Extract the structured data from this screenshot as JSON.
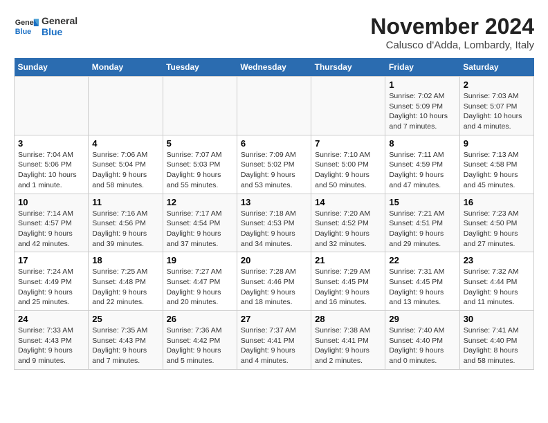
{
  "header": {
    "logo_line1": "General",
    "logo_line2": "Blue",
    "month": "November 2024",
    "location": "Calusco d'Adda, Lombardy, Italy"
  },
  "weekdays": [
    "Sunday",
    "Monday",
    "Tuesday",
    "Wednesday",
    "Thursday",
    "Friday",
    "Saturday"
  ],
  "weeks": [
    [
      {
        "day": "",
        "info": ""
      },
      {
        "day": "",
        "info": ""
      },
      {
        "day": "",
        "info": ""
      },
      {
        "day": "",
        "info": ""
      },
      {
        "day": "",
        "info": ""
      },
      {
        "day": "1",
        "info": "Sunrise: 7:02 AM\nSunset: 5:09 PM\nDaylight: 10 hours and 7 minutes."
      },
      {
        "day": "2",
        "info": "Sunrise: 7:03 AM\nSunset: 5:07 PM\nDaylight: 10 hours and 4 minutes."
      }
    ],
    [
      {
        "day": "3",
        "info": "Sunrise: 7:04 AM\nSunset: 5:06 PM\nDaylight: 10 hours and 1 minute."
      },
      {
        "day": "4",
        "info": "Sunrise: 7:06 AM\nSunset: 5:04 PM\nDaylight: 9 hours and 58 minutes."
      },
      {
        "day": "5",
        "info": "Sunrise: 7:07 AM\nSunset: 5:03 PM\nDaylight: 9 hours and 55 minutes."
      },
      {
        "day": "6",
        "info": "Sunrise: 7:09 AM\nSunset: 5:02 PM\nDaylight: 9 hours and 53 minutes."
      },
      {
        "day": "7",
        "info": "Sunrise: 7:10 AM\nSunset: 5:00 PM\nDaylight: 9 hours and 50 minutes."
      },
      {
        "day": "8",
        "info": "Sunrise: 7:11 AM\nSunset: 4:59 PM\nDaylight: 9 hours and 47 minutes."
      },
      {
        "day": "9",
        "info": "Sunrise: 7:13 AM\nSunset: 4:58 PM\nDaylight: 9 hours and 45 minutes."
      }
    ],
    [
      {
        "day": "10",
        "info": "Sunrise: 7:14 AM\nSunset: 4:57 PM\nDaylight: 9 hours and 42 minutes."
      },
      {
        "day": "11",
        "info": "Sunrise: 7:16 AM\nSunset: 4:56 PM\nDaylight: 9 hours and 39 minutes."
      },
      {
        "day": "12",
        "info": "Sunrise: 7:17 AM\nSunset: 4:54 PM\nDaylight: 9 hours and 37 minutes."
      },
      {
        "day": "13",
        "info": "Sunrise: 7:18 AM\nSunset: 4:53 PM\nDaylight: 9 hours and 34 minutes."
      },
      {
        "day": "14",
        "info": "Sunrise: 7:20 AM\nSunset: 4:52 PM\nDaylight: 9 hours and 32 minutes."
      },
      {
        "day": "15",
        "info": "Sunrise: 7:21 AM\nSunset: 4:51 PM\nDaylight: 9 hours and 29 minutes."
      },
      {
        "day": "16",
        "info": "Sunrise: 7:23 AM\nSunset: 4:50 PM\nDaylight: 9 hours and 27 minutes."
      }
    ],
    [
      {
        "day": "17",
        "info": "Sunrise: 7:24 AM\nSunset: 4:49 PM\nDaylight: 9 hours and 25 minutes."
      },
      {
        "day": "18",
        "info": "Sunrise: 7:25 AM\nSunset: 4:48 PM\nDaylight: 9 hours and 22 minutes."
      },
      {
        "day": "19",
        "info": "Sunrise: 7:27 AM\nSunset: 4:47 PM\nDaylight: 9 hours and 20 minutes."
      },
      {
        "day": "20",
        "info": "Sunrise: 7:28 AM\nSunset: 4:46 PM\nDaylight: 9 hours and 18 minutes."
      },
      {
        "day": "21",
        "info": "Sunrise: 7:29 AM\nSunset: 4:45 PM\nDaylight: 9 hours and 16 minutes."
      },
      {
        "day": "22",
        "info": "Sunrise: 7:31 AM\nSunset: 4:45 PM\nDaylight: 9 hours and 13 minutes."
      },
      {
        "day": "23",
        "info": "Sunrise: 7:32 AM\nSunset: 4:44 PM\nDaylight: 9 hours and 11 minutes."
      }
    ],
    [
      {
        "day": "24",
        "info": "Sunrise: 7:33 AM\nSunset: 4:43 PM\nDaylight: 9 hours and 9 minutes."
      },
      {
        "day": "25",
        "info": "Sunrise: 7:35 AM\nSunset: 4:43 PM\nDaylight: 9 hours and 7 minutes."
      },
      {
        "day": "26",
        "info": "Sunrise: 7:36 AM\nSunset: 4:42 PM\nDaylight: 9 hours and 5 minutes."
      },
      {
        "day": "27",
        "info": "Sunrise: 7:37 AM\nSunset: 4:41 PM\nDaylight: 9 hours and 4 minutes."
      },
      {
        "day": "28",
        "info": "Sunrise: 7:38 AM\nSunset: 4:41 PM\nDaylight: 9 hours and 2 minutes."
      },
      {
        "day": "29",
        "info": "Sunrise: 7:40 AM\nSunset: 4:40 PM\nDaylight: 9 hours and 0 minutes."
      },
      {
        "day": "30",
        "info": "Sunrise: 7:41 AM\nSunset: 4:40 PM\nDaylight: 8 hours and 58 minutes."
      }
    ]
  ]
}
